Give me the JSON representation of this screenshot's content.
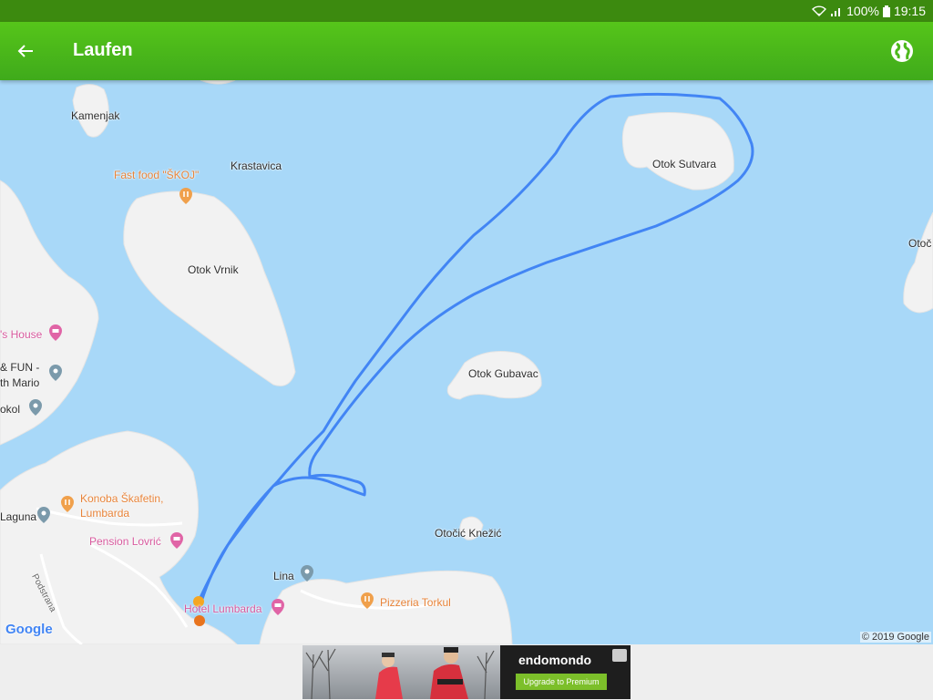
{
  "status_bar": {
    "battery": "100%",
    "time": "19:15"
  },
  "app_bar": {
    "title": "Laufen"
  },
  "map": {
    "places": {
      "kamenjak": "Kamenjak",
      "krastavica": "Krastavica",
      "fast_food": "Fast food \"ŠKOJ\"",
      "otok_vrnik": "Otok Vrnik",
      "otok_sutvara": "Otok Sutvara",
      "otoc_partial": "Otoč",
      "otok_gubavac": "Otok Gubavac",
      "house_partial": "'s House",
      "fun_partial": "& FUN -",
      "mario_partial": "th Mario",
      "sokol_partial": "okol",
      "konoba_line1": "Konoba Škafetin,",
      "konoba_line2": "Lumbarda",
      "laguna_partial": "Laguna",
      "pension": "Pension Lovrić",
      "podstrana": "Podstrana",
      "lina": "Lina",
      "hotel": "Hotel Lumbarda",
      "pizzeria": "Pizzeria Torkul",
      "otocic_knezic": "Otočić Knežić"
    },
    "google_logo": "Google",
    "copyright": "© 2019 Google"
  },
  "ad": {
    "brand": "endomondo",
    "cta": "Upgrade to Premium"
  },
  "colors": {
    "water": "#a8d8f8",
    "land": "#f2f2f2",
    "route": "#4285f4",
    "appbar": "#4cb81a",
    "statusbar": "#3c8a0f",
    "start_marker": "#f5a623",
    "end_marker": "#e8741e"
  }
}
